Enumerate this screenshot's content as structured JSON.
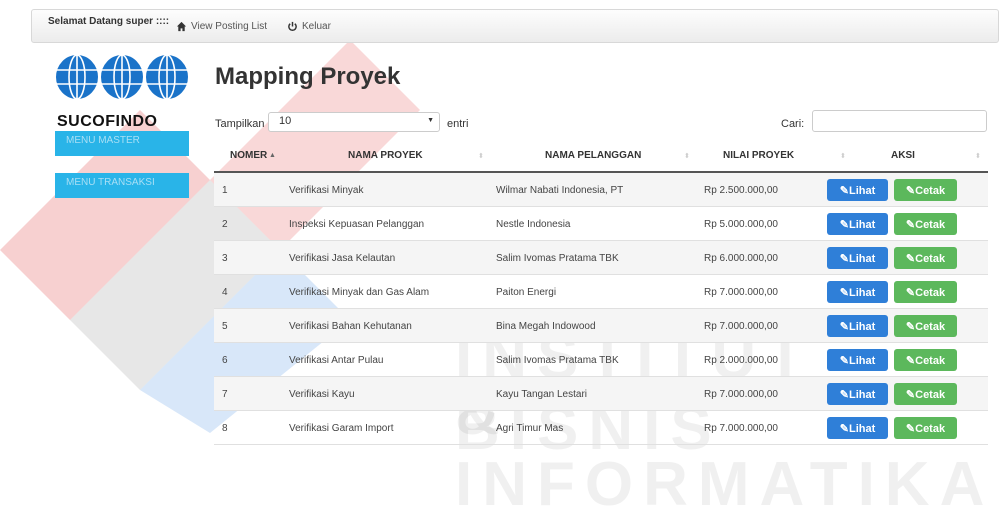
{
  "navbar": {
    "welcome": "Selamat Datang super ::::",
    "links": [
      {
        "label": "View Posting List",
        "icon": "home-icon"
      },
      {
        "label": "Keluar",
        "icon": "power-icon"
      }
    ]
  },
  "logo": {
    "text": "SUCOFINDO"
  },
  "sidebar": {
    "items": [
      {
        "label": "MENU MASTER"
      },
      {
        "label": "MENU TRANSAKSI"
      }
    ]
  },
  "page": {
    "title": "Mapping Proyek"
  },
  "controls": {
    "show_label": "Tampilkan",
    "page_size": "10",
    "entries_label": "entri",
    "search_label": "Cari:",
    "search_value": ""
  },
  "table": {
    "headers": [
      "NOMER",
      "NAMA PROYEK",
      "NAMA PELANGGAN",
      "NILAI PROYEK",
      "AKSI"
    ],
    "button_lihat": "Lihat",
    "button_cetak": "Cetak",
    "rows": [
      {
        "no": "1",
        "proyek": "Verifikasi Minyak",
        "pelanggan": "Wilmar Nabati Indonesia, PT",
        "nilai": "Rp 2.500.000,00"
      },
      {
        "no": "2",
        "proyek": "Inspeksi Kepuasan Pelanggan",
        "pelanggan": "Nestle Indonesia",
        "nilai": "Rp 5.000.000,00"
      },
      {
        "no": "3",
        "proyek": "Verifikasi Jasa Kelautan",
        "pelanggan": "Salim Ivomas Pratama TBK",
        "nilai": "Rp 6.000.000,00"
      },
      {
        "no": "4",
        "proyek": "Verifikasi Minyak dan Gas Alam",
        "pelanggan": "Paiton Energi",
        "nilai": "Rp 7.000.000,00"
      },
      {
        "no": "5",
        "proyek": "Verifikasi Bahan Kehutanan",
        "pelanggan": "Bina Megah Indowood",
        "nilai": "Rp 7.000.000,00"
      },
      {
        "no": "6",
        "proyek": "Verifikasi Antar Pulau",
        "pelanggan": "Salim Ivomas Pratama TBK",
        "nilai": "Rp 2.000.000,00"
      },
      {
        "no": "7",
        "proyek": "Verifikasi Kayu",
        "pelanggan": "Kayu Tangan Lestari",
        "nilai": "Rp 7.000.000,00"
      },
      {
        "no": "8",
        "proyek": "Verifikasi Garam Import",
        "pelanggan": "Agri Timur Mas",
        "nilai": "Rp 7.000.000,00"
      }
    ]
  },
  "watermark": {
    "line1": "INSTITUT BISNIS",
    "line2": "& INFORMATIKA"
  },
  "colors": {
    "menu": "#29b4e8",
    "lihat": "#2f7fd8",
    "cetak": "#5cb85c",
    "logo_blue": "#1a73c9"
  }
}
